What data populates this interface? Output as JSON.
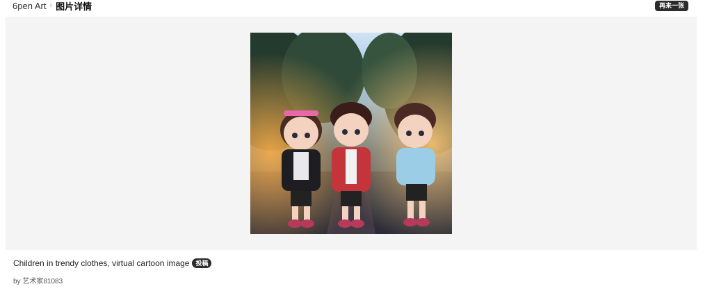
{
  "breadcrumb": {
    "home": "6pen Art",
    "separator": "›",
    "current": "图片详情"
  },
  "actions": {
    "again_label": "再来一张"
  },
  "image": {
    "alt": "Children in trendy clothes, virtual cartoon image"
  },
  "caption": {
    "title": "Children in trendy clothes, virtual cartoon image",
    "tag": "投稿",
    "author_prefix": "by",
    "author": "艺术家81083"
  },
  "colors": {
    "stage_bg": "#f4f4f4",
    "button_bg": "#2b2b2b"
  }
}
